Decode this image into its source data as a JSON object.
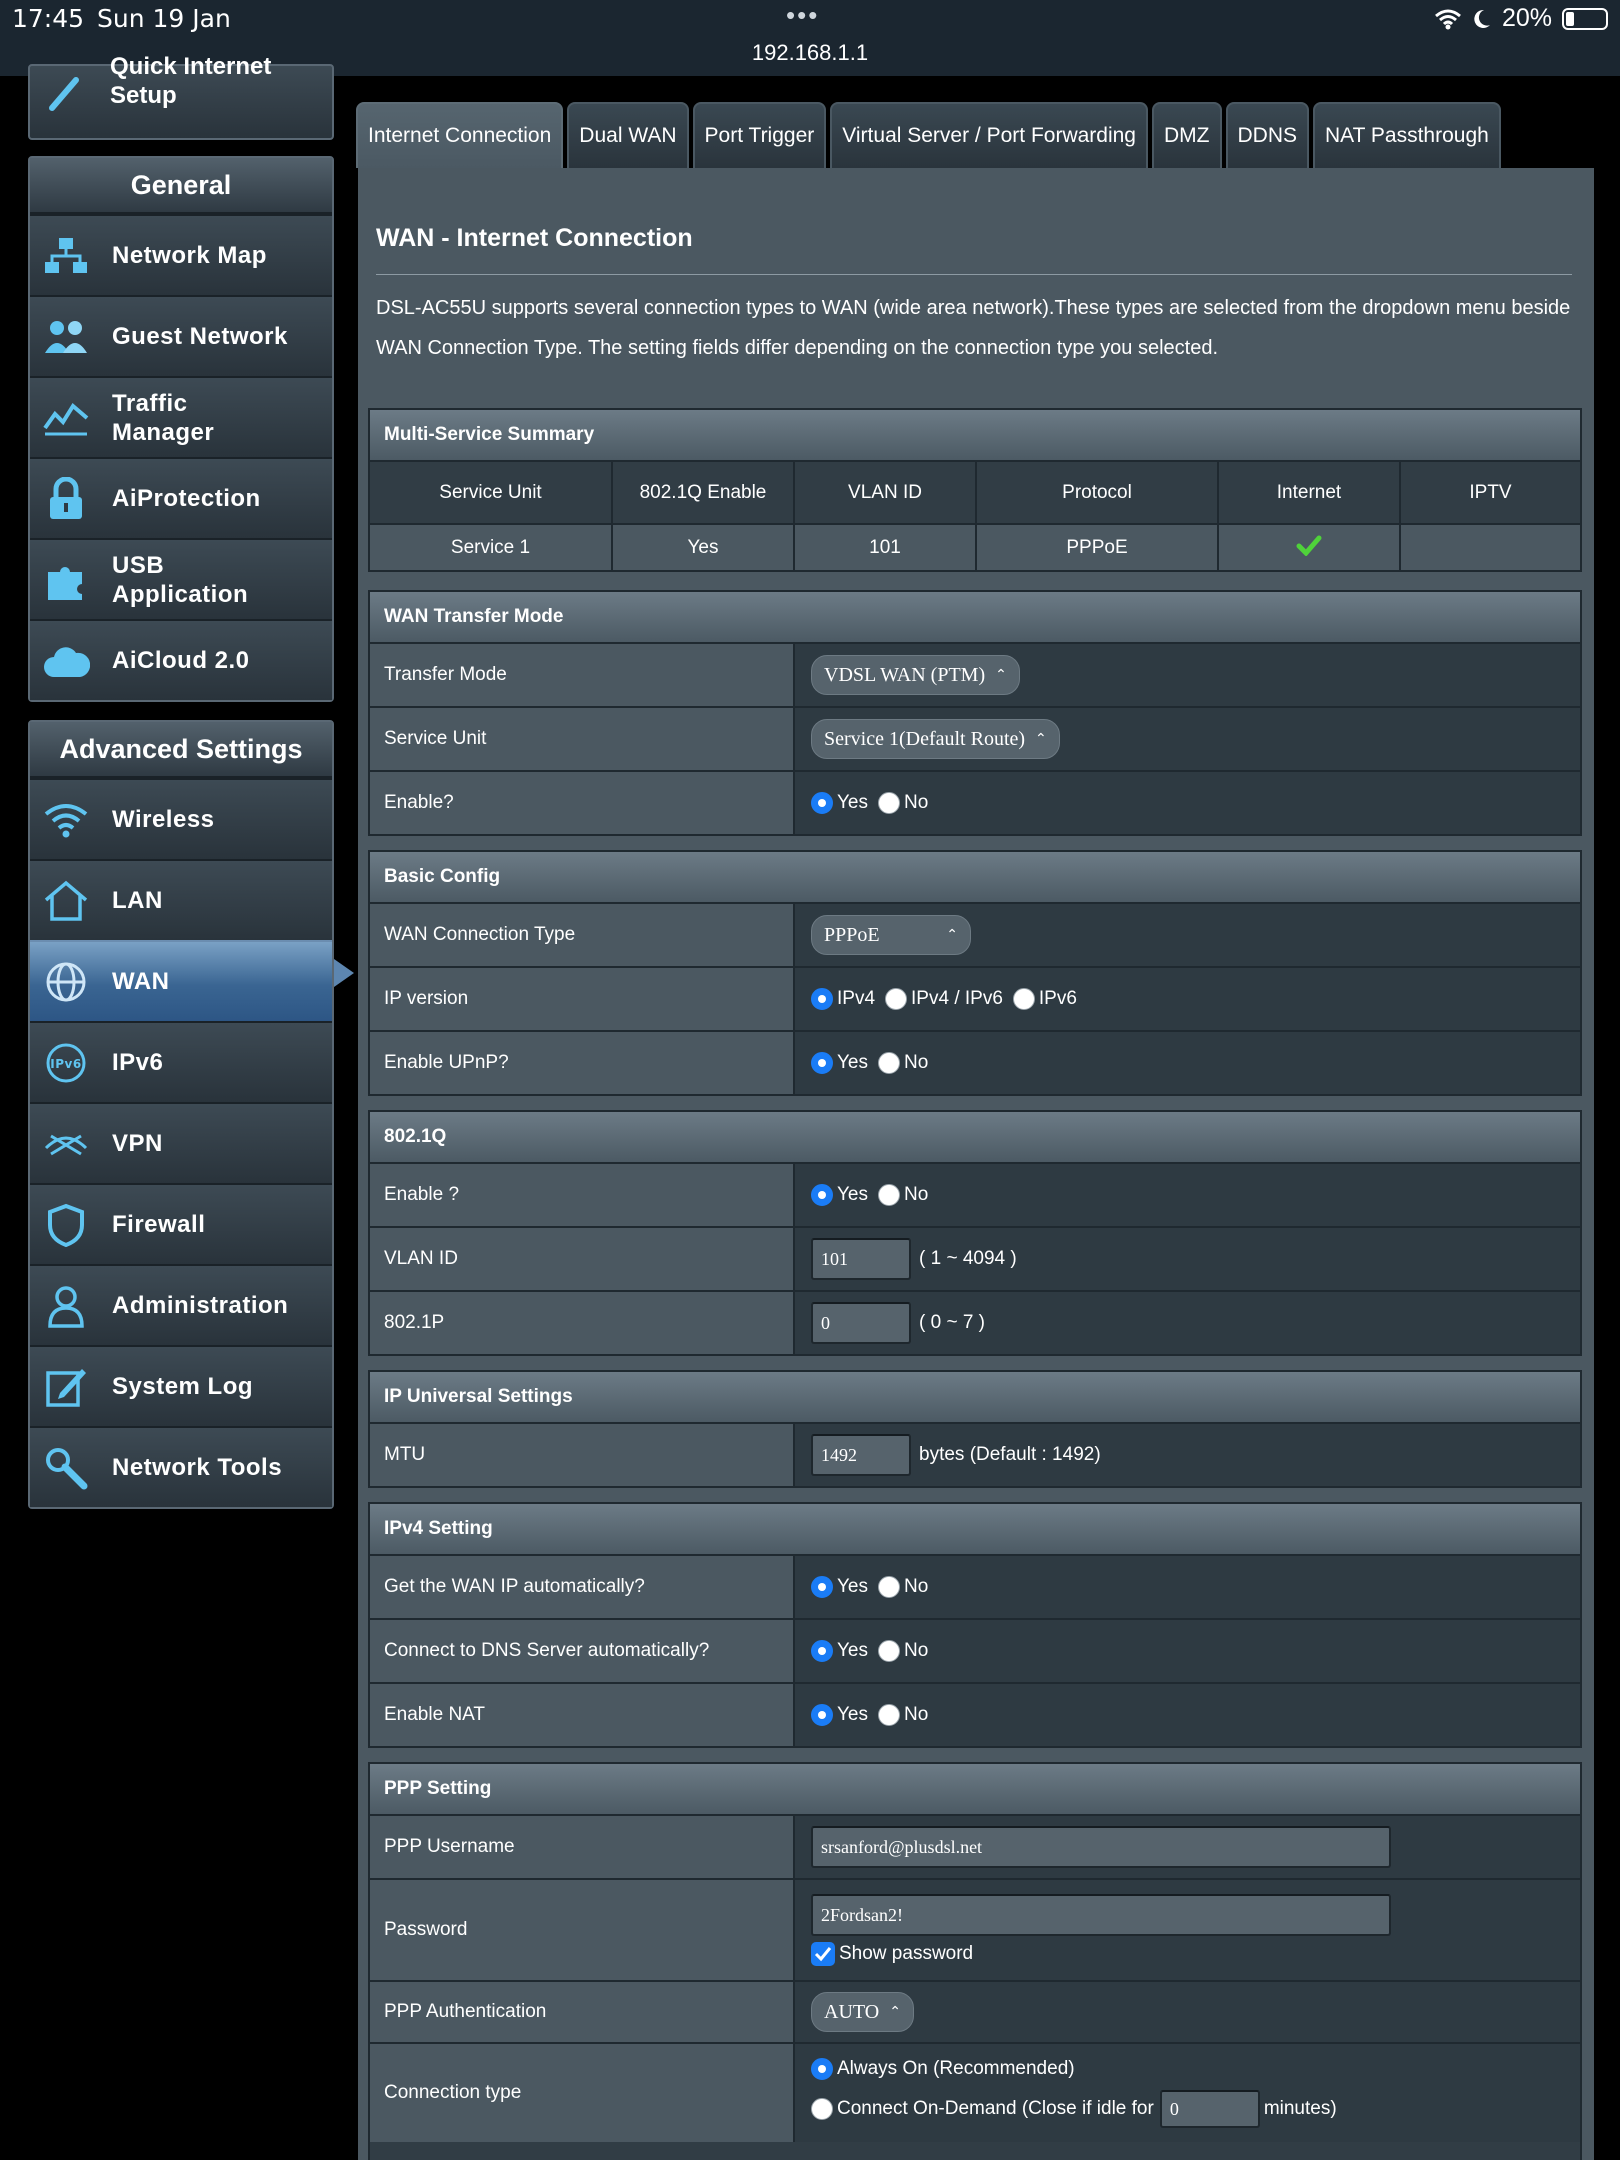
{
  "status_bar": {
    "time": "17:45",
    "date": "Sun 19 Jan",
    "url": "192.168.1.1",
    "battery": "20%"
  },
  "sidebar": {
    "quick_setup_label": "Quick Internet Setup",
    "general_header": "General",
    "general_items": [
      {
        "label": "Network Map",
        "icon": "network-map-icon"
      },
      {
        "label": "Guest Network",
        "icon": "guest-network-icon"
      },
      {
        "label": "Traffic Manager",
        "icon": "traffic-manager-icon"
      },
      {
        "label": "AiProtection",
        "icon": "lock-icon"
      },
      {
        "label": "USB Application",
        "icon": "puzzle-icon"
      },
      {
        "label": "AiCloud 2.0",
        "icon": "cloud-icon"
      }
    ],
    "advanced_header": "Advanced Settings",
    "advanced_items": [
      {
        "label": "Wireless",
        "icon": "wifi-icon"
      },
      {
        "label": "LAN",
        "icon": "home-icon"
      },
      {
        "label": "WAN",
        "icon": "globe-icon"
      },
      {
        "label": "IPv6",
        "icon": "ipv6-icon"
      },
      {
        "label": "VPN",
        "icon": "vpn-icon"
      },
      {
        "label": "Firewall",
        "icon": "shield-icon"
      },
      {
        "label": "Administration",
        "icon": "user-icon"
      },
      {
        "label": "System Log",
        "icon": "edit-icon"
      },
      {
        "label": "Network Tools",
        "icon": "wrench-icon"
      }
    ]
  },
  "tabs": [
    "Internet Connection",
    "Dual WAN",
    "Port Trigger",
    "Virtual Server / Port Forwarding",
    "DMZ",
    "DDNS",
    "NAT Passthrough"
  ],
  "page": {
    "title": "WAN - Internet Connection",
    "description": "DSL-AC55U supports several connection types to WAN (wide area network).These types are selected from the dropdown menu beside WAN Connection Type. The setting fields differ depending on the connection type you selected."
  },
  "summary": {
    "header": "Multi-Service Summary",
    "columns": [
      "Service Unit",
      "802.1Q Enable",
      "VLAN ID",
      "Protocol",
      "Internet",
      "IPTV"
    ],
    "rows": [
      [
        "Service 1",
        "Yes",
        "101",
        "PPPoE",
        "",
        ""
      ]
    ]
  },
  "transfer": {
    "header": "WAN Transfer Mode",
    "mode_label": "Transfer Mode",
    "mode_value": "VDSL WAN (PTM)",
    "unit_label": "Service Unit",
    "unit_value": "Service 1(Default Route)",
    "enable_label": "Enable?"
  },
  "radio": {
    "yes": "Yes",
    "no": "No"
  },
  "basic": {
    "header": "Basic Config",
    "conn_type_label": "WAN Connection Type",
    "conn_type_value": "PPPoE",
    "ipver_label": "IP version",
    "ipver_options": [
      "IPv4",
      "IPv4 / IPv6",
      "IPv6"
    ],
    "upnp_label": "Enable UPnP?"
  },
  "dot1q": {
    "header": "802.1Q",
    "enable_label": "Enable ?",
    "vlan_label": "VLAN ID",
    "vlan_value": "101",
    "vlan_hint": "( 1 ~ 4094 )",
    "p_label": "802.1P",
    "p_value": "0",
    "p_hint": "( 0 ~ 7 )"
  },
  "ip_universal": {
    "header": "IP Universal Settings",
    "mtu_label": "MTU",
    "mtu_value": "1492",
    "mtu_hint": "bytes (Default : 1492)"
  },
  "ipv4": {
    "header": "IPv4 Setting",
    "wan_ip_label": "Get the WAN IP automatically?",
    "dns_label": "Connect to DNS Server automatically?",
    "nat_label": "Enable NAT"
  },
  "ppp": {
    "header": "PPP Setting",
    "username_label": "PPP Username",
    "username_value": "srsanford@plusdsl.net",
    "password_label": "Password",
    "password_value": "2Fordsan2!",
    "show_password_label": "Show password",
    "auth_label": "PPP Authentication",
    "auth_value": "AUTO",
    "conn_type_label": "Connection type",
    "always_on": "Always On (Recommended)",
    "on_demand": "Connect On-Demand (Close if idle for",
    "idle_value": "0",
    "minutes": "minutes)"
  },
  "colors": {
    "accent": "#1a7cf6",
    "active_nav": "#3a6592",
    "panel": "#4b5861"
  }
}
